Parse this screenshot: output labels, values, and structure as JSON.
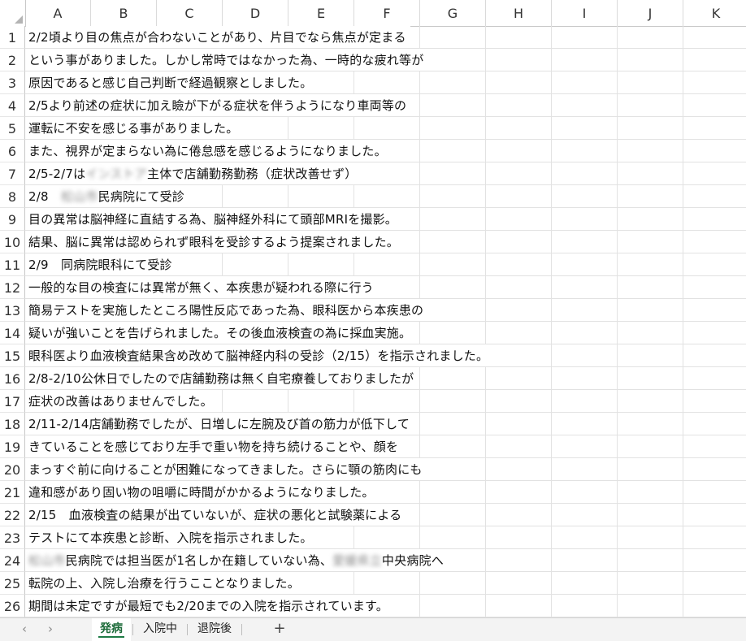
{
  "columns": [
    "A",
    "B",
    "C",
    "D",
    "E",
    "F",
    "G",
    "H",
    "I",
    "J",
    "K"
  ],
  "rows": [
    {
      "num": "1",
      "parts": [
        {
          "t": "2/2頃より目の焦点が合わないことがあり、片目でなら焦点が定まる"
        }
      ]
    },
    {
      "num": "2",
      "parts": [
        {
          "t": "という事がありました。しかし常時ではなかった為、一時的な疲れ等が"
        }
      ]
    },
    {
      "num": "3",
      "parts": [
        {
          "t": "原因であると感じ自己判断で経過観察としました。"
        }
      ]
    },
    {
      "num": "4",
      "parts": [
        {
          "t": "2/5より前述の症状に加え瞼が下がる症状を伴うようになり車両等の"
        }
      ]
    },
    {
      "num": "5",
      "parts": [
        {
          "t": "運転に不安を感じる事がありました。"
        }
      ]
    },
    {
      "num": "6",
      "parts": [
        {
          "t": "また、視界が定まらない為に倦怠感を感じるようになりました。"
        }
      ]
    },
    {
      "num": "7",
      "parts": [
        {
          "t": "2/5-2/7は"
        },
        {
          "t": "インストア",
          "blur": true
        },
        {
          "t": "主体で店舗勤務勤務（症状改善せず）"
        }
      ]
    },
    {
      "num": "8",
      "parts": [
        {
          "t": "2/8　"
        },
        {
          "t": "松山市",
          "blur": true
        },
        {
          "t": "民病院にて受診"
        }
      ]
    },
    {
      "num": "9",
      "parts": [
        {
          "t": "目の異常は脳神経に直結する為、脳神経外科にて頭部MRIを撮影。"
        }
      ]
    },
    {
      "num": "10",
      "parts": [
        {
          "t": "結果、脳に異常は認められず眼科を受診するよう提案されました。"
        }
      ]
    },
    {
      "num": "11",
      "parts": [
        {
          "t": "2/9　同病院眼科にて受診"
        }
      ]
    },
    {
      "num": "12",
      "parts": [
        {
          "t": "一般的な目の検査には異常が無く、本疾患が疑われる際に行う"
        }
      ]
    },
    {
      "num": "13",
      "parts": [
        {
          "t": "簡易テストを実施したところ陽性反応であった為、眼科医から本疾患の"
        }
      ]
    },
    {
      "num": "14",
      "parts": [
        {
          "t": "疑いが強いことを告げられました。その後血液検査の為に採血実施。"
        }
      ]
    },
    {
      "num": "15",
      "parts": [
        {
          "t": "眼科医より血液検査結果含め改めて脳神経内科の受診（2/15）を指示されました。"
        }
      ]
    },
    {
      "num": "16",
      "parts": [
        {
          "t": "2/8-2/10公休日でしたので店舗勤務は無く自宅療養しておりましたが"
        }
      ]
    },
    {
      "num": "17",
      "parts": [
        {
          "t": "症状の改善はありませんでした。"
        }
      ]
    },
    {
      "num": "18",
      "parts": [
        {
          "t": "2/11-2/14店舗勤務でしたが、日増しに左腕及び首の筋力が低下して"
        }
      ]
    },
    {
      "num": "19",
      "parts": [
        {
          "t": "きていることを感じており左手で重い物を持ち続けることや、顔を"
        }
      ]
    },
    {
      "num": "20",
      "parts": [
        {
          "t": "まっすぐ前に向けることが困難になってきました。さらに顎の筋肉にも"
        }
      ]
    },
    {
      "num": "21",
      "parts": [
        {
          "t": "違和感があり固い物の咀嚼に時間がかかるようになりました。"
        }
      ]
    },
    {
      "num": "22",
      "parts": [
        {
          "t": "2/15　血液検査の結果が出ていないが、症状の悪化と試験薬による"
        }
      ]
    },
    {
      "num": "23",
      "parts": [
        {
          "t": "テストにて本疾患と診断、入院を指示されました。"
        }
      ]
    },
    {
      "num": "24",
      "parts": [
        {
          "t": "松山市",
          "blur": true
        },
        {
          "t": "民病院では担当医が1名しか在籍していない為、"
        },
        {
          "t": "愛媛県立",
          "blur": true
        },
        {
          "t": "中央病院へ"
        }
      ]
    },
    {
      "num": "25",
      "parts": [
        {
          "t": "転院の上、入院し治療を行うこことなりました。"
        }
      ]
    },
    {
      "num": "26",
      "parts": [
        {
          "t": "期間は未定ですが最短でも2/20までの入院を指示されています。"
        }
      ]
    }
  ],
  "sheet_tabs": [
    {
      "label": "発病",
      "active": true
    },
    {
      "label": "入院中",
      "active": false
    },
    {
      "label": "退院後",
      "active": false
    }
  ],
  "nav": {
    "prev": "‹",
    "next": "›",
    "add": "+"
  },
  "colors": {
    "accent": "#1d7b45",
    "grid": "#e2e2e2",
    "header_border": "#c8c8c8"
  }
}
